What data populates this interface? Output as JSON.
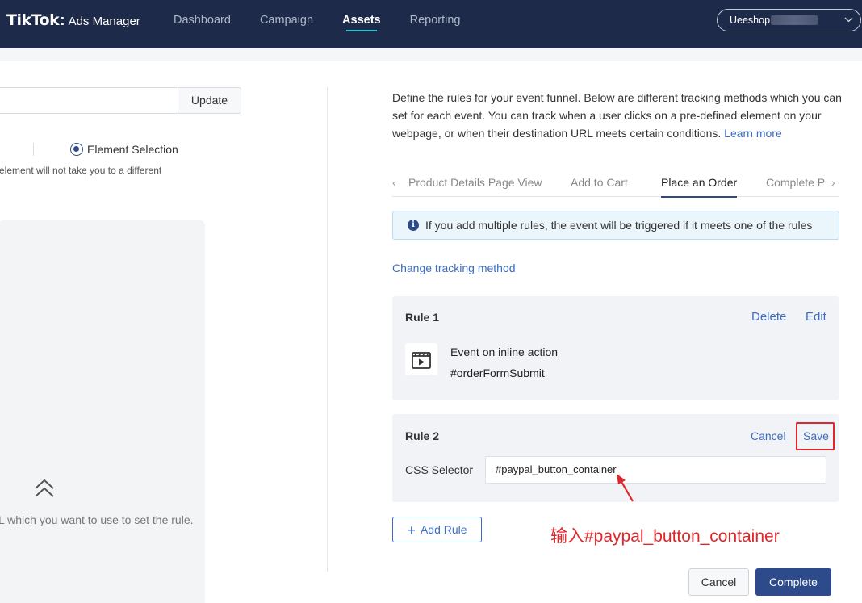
{
  "header": {
    "logo_main": "TikTok",
    "logo_dot": ":",
    "logo_sub": "Ads Manager",
    "nav": [
      "Dashboard",
      "Campaign",
      "Assets",
      "Reporting"
    ],
    "active_nav": "Assets",
    "account": "Ueeshop"
  },
  "left": {
    "url_value": "",
    "update_label": "Update",
    "radio_label": "Element Selection",
    "hint": "element will not take you to a different",
    "preview_text": "L which you want to use to set the rule."
  },
  "right": {
    "intro": "Define the rules for your event funnel. Below are different tracking methods which you can set for each event. You can track when a user clicks on a pre-defined element on your webpage, or when their destination URL meets certain conditions.",
    "learn_more": "Learn more",
    "tabs": [
      "Product Details Page View",
      "Add to Cart",
      "Place an Order",
      "Complete P"
    ],
    "active_tab": "Place an Order",
    "notice": "If you add multiple rules, the event will be triggered if it meets one of the rules",
    "change_method": "Change tracking method",
    "rule1": {
      "title": "Rule 1",
      "delete": "Delete",
      "edit": "Edit",
      "event_title": "Event on inline action",
      "event_value": "#orderFormSubmit"
    },
    "rule2": {
      "title": "Rule 2",
      "cancel": "Cancel",
      "save": "Save",
      "css_label": "CSS Selector",
      "css_value": "#paypal_button_container"
    },
    "add_rule": "Add Rule",
    "annotation": "输入#paypal_button_container",
    "cancel": "Cancel",
    "complete": "Complete"
  },
  "colors": {
    "nav_bg": "#1e2a4a",
    "accent": "#2d4a8a",
    "link": "#3b6dc3",
    "highlight": "#e0262a",
    "nav_underline": "#29c4d6"
  }
}
